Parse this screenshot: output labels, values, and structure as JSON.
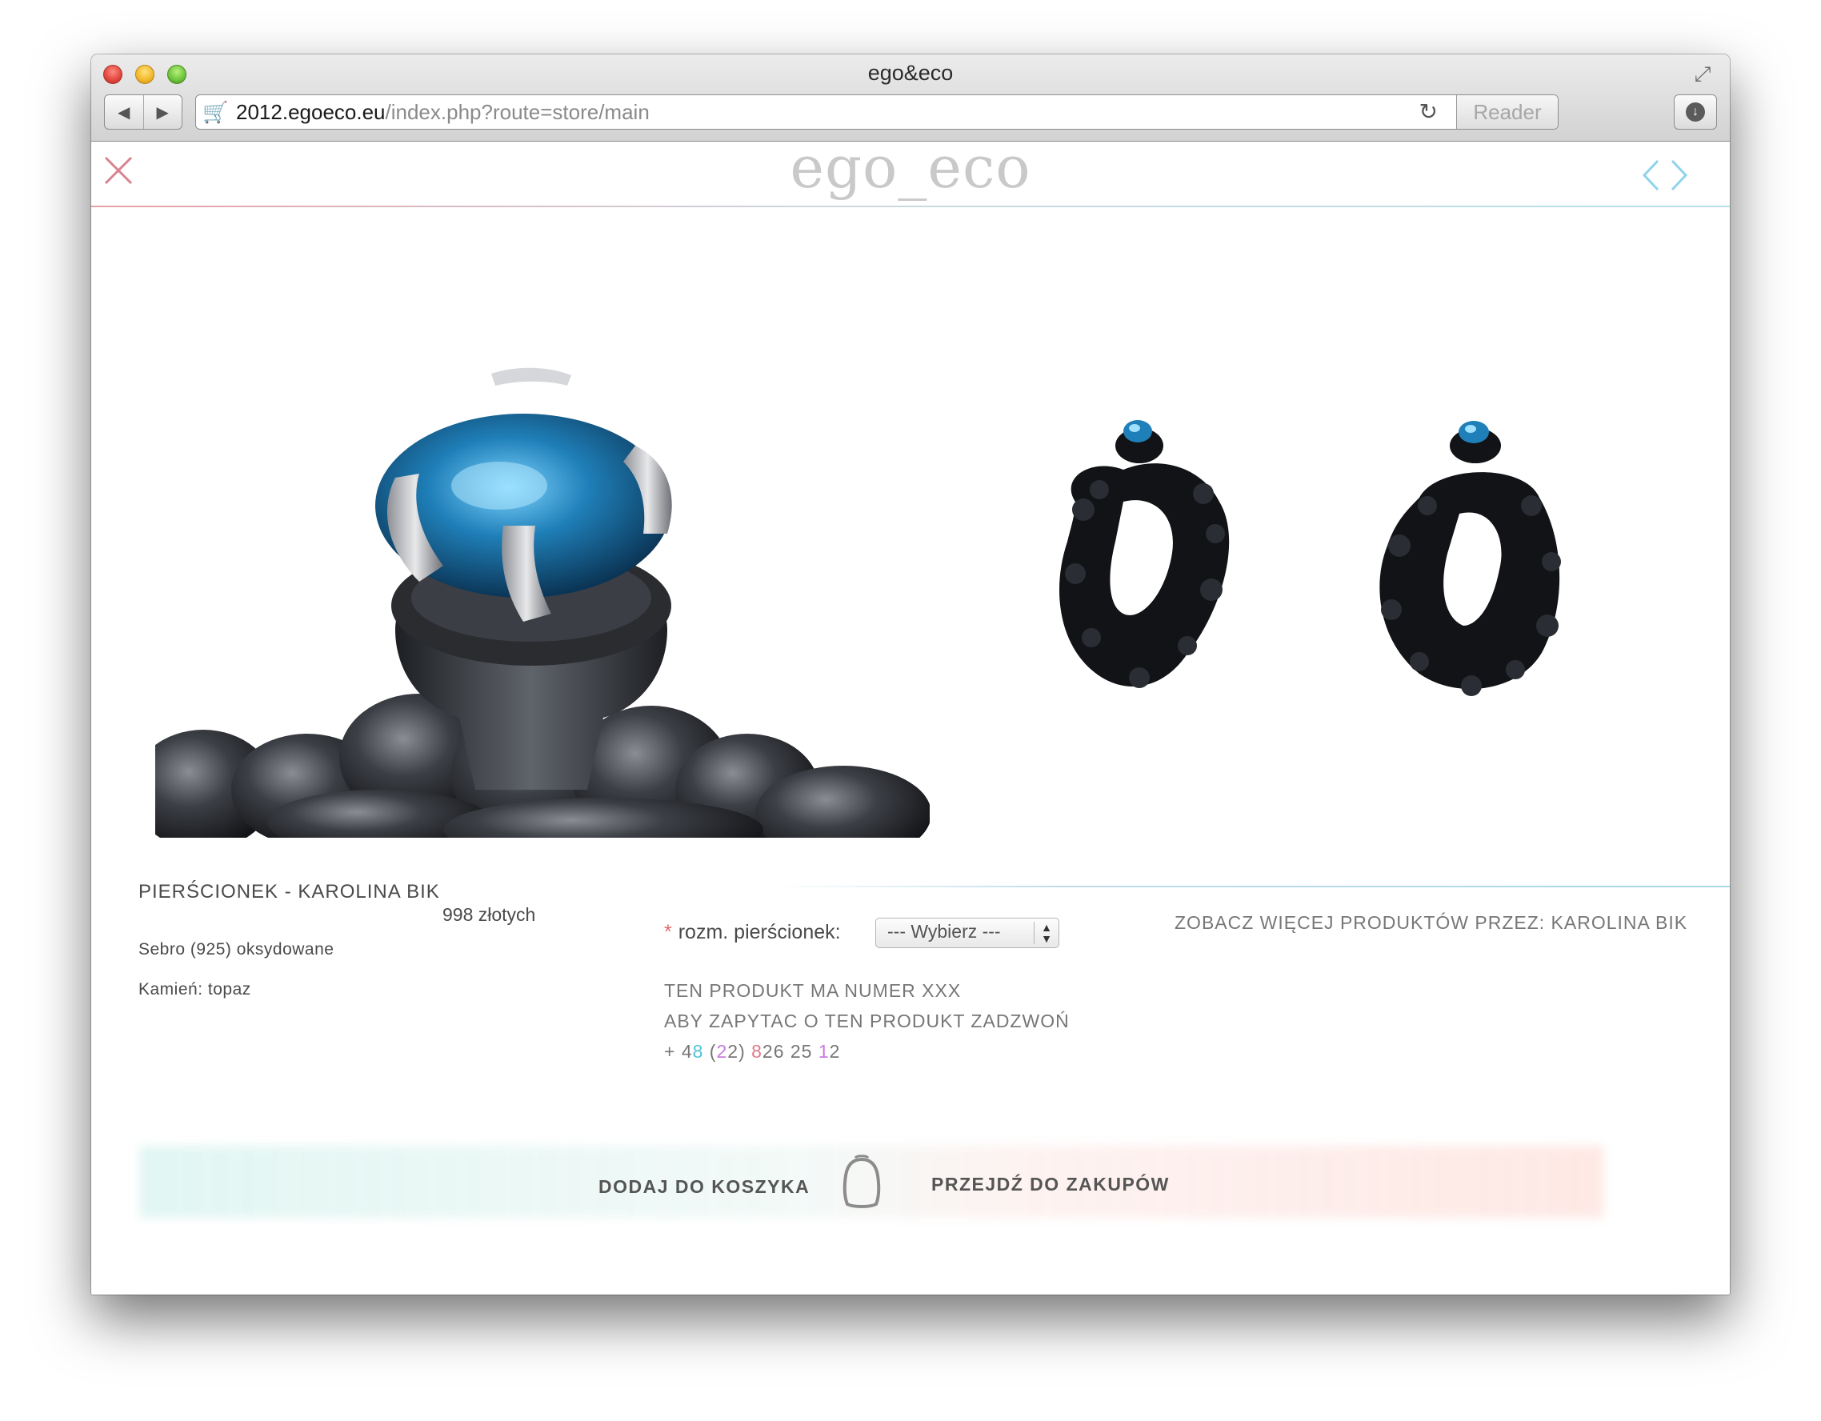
{
  "browser": {
    "window_title": "ego&eco",
    "url_host": "2012.egoeco.eu",
    "url_path": "/index.php?route=store/main",
    "reader_label": "Reader"
  },
  "site": {
    "logo": "ego_eco"
  },
  "product": {
    "title": "PIERŚCIONEK - KAROLINA BIK",
    "price": "998 złotych",
    "material": "Sebro (925) oksydowane",
    "stone": "Kamień: topaz",
    "option_required": "*",
    "option_label": "rozm. pierścionek:",
    "option_selected": "--- Wybierz ---",
    "more_products": "ZOBACZ WIĘCEJ PRODUKTÓW PRZEZ: KAROLINA BIK",
    "info_line1": "TEN PRODUKT MA NUMER XXX",
    "info_line2": "ABY ZAPYTAC O TEN PRODUKT ZADZWOŃ",
    "phone": {
      "p1": "+ 4",
      "p2": "8",
      "p3": " (",
      "p4": "2",
      "p5": "2) ",
      "p6": "8",
      "p7": "26 25 ",
      "p8": "1",
      "p9": "2"
    }
  },
  "actions": {
    "add_to_cart": "DODAJ DO KOSZYKA",
    "checkout": "PRZEJDŹ DO ZAKUPÓW"
  },
  "colors": {
    "close_x": "#d9828f",
    "arrows": "#8fd3ea",
    "stone_blue": "#1f7fb8",
    "metal_dark": "#2a2c30"
  }
}
